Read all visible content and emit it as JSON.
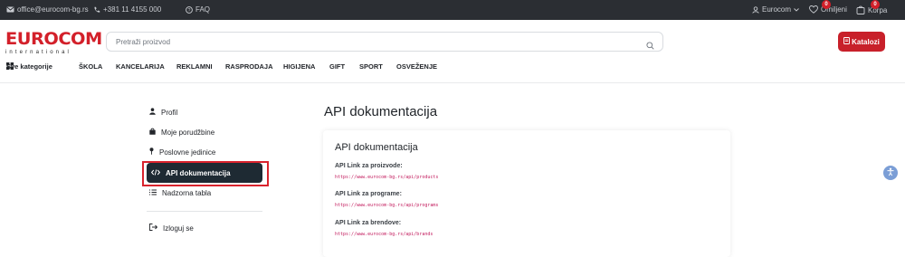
{
  "topbar": {
    "email": "office@eurocom-bg.rs",
    "phone": "+381 11 4155 000",
    "faq": "FAQ",
    "account": "Eurocom",
    "favorites_label": "Omiljeni",
    "favorites_count": "0",
    "cart_label": "Korpa",
    "cart_count": "0"
  },
  "header": {
    "logo_word": "EUROCOM",
    "logo_sub": "international",
    "search_placeholder": "Pretraži proizvod",
    "katalozi_label": "Katalozi"
  },
  "nav": {
    "all_categories": "Sve kategorije",
    "items": [
      "ŠKOLA",
      "KANCELARIJA",
      "REKLAMNI",
      "RASPRODAJA",
      "HIGIJENA",
      "GIFT",
      "SPORT",
      "OSVEŽENJE"
    ]
  },
  "sidebar": {
    "items": [
      "Profil",
      "Moje porudžbine",
      "Poslovne jedinice",
      "API dokumentacija",
      "Nadzorna tabla"
    ],
    "logout": "Izloguj se"
  },
  "main": {
    "title": "API dokumentacija",
    "card_title": "API dokumentacija",
    "links": [
      {
        "label": "API Link za proizvode:",
        "url": "https://www.eurocom-bg.rs/api/products"
      },
      {
        "label": "API Link za programe:",
        "url": "https://www.eurocom-bg.rs/api/programs"
      },
      {
        "label": "API Link za brendove:",
        "url": "https://www.eurocom-bg.rs/api/brands"
      }
    ]
  },
  "colors": {
    "brand_red": "#d3202a",
    "topbar_bg": "#2b2e33",
    "active_item_bg": "#1e2a33",
    "url_pink": "#c2185b"
  }
}
